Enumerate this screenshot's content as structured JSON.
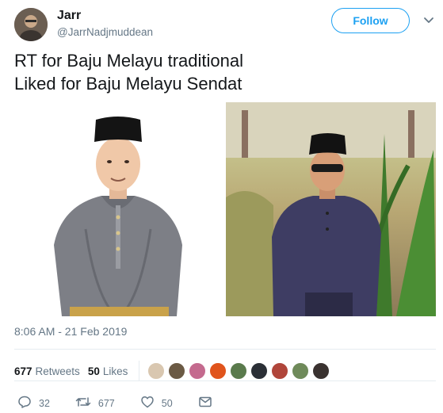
{
  "tweet": {
    "display_name": "Jarr",
    "handle": "@JarrNadjmuddean",
    "follow_label": "Follow",
    "text_line1": "RT for Baju Melayu traditional",
    "text_line2": "Liked for Baju Melayu Sendat",
    "timestamp": "8:06 AM - 21 Feb 2019",
    "retweets_count": "677",
    "retweets_label": "Retweets",
    "likes_count": "50",
    "likes_label": "Likes",
    "actions": {
      "reply_count": "32",
      "retweet_count": "677",
      "like_count": "50"
    }
  },
  "icons": {
    "caret": "chevron-down-icon",
    "reply": "reply-icon",
    "retweet": "retweet-icon",
    "like": "heart-icon",
    "dm": "envelope-icon"
  },
  "colors": {
    "accent": "#1da1f2",
    "text": "#14171a",
    "secondary": "#657786",
    "divider": "#e6ecf0"
  }
}
